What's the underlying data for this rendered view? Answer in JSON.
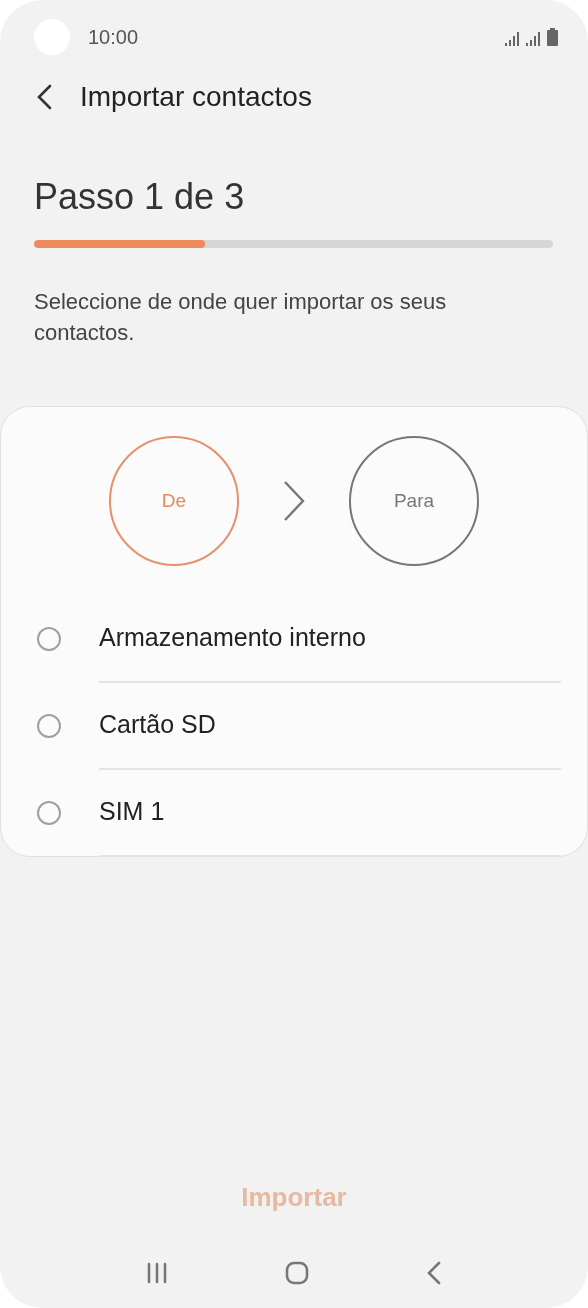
{
  "status_bar": {
    "time": "10:00"
  },
  "header": {
    "title": "Importar contactos"
  },
  "step": {
    "title": "Passo 1 de 3",
    "level": 0.33
  },
  "description": "Seleccione de onde quer importar os seus contactos.",
  "flow": [
    {
      "label": "De",
      "active": true
    },
    {
      "label": "Para",
      "active": false
    }
  ],
  "options": [
    {
      "label": "Armazenamento interno",
      "selected": false
    },
    {
      "label": "Cartão SD",
      "selected": false
    },
    {
      "label": "SIM 1",
      "selected": false
    }
  ],
  "import_button": {
    "label": "Importar",
    "disabled": true
  }
}
